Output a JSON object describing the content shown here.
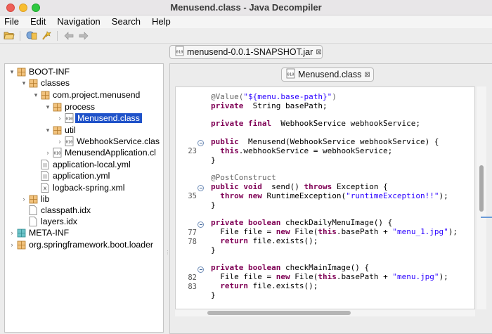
{
  "window": {
    "title": "Menusend.class - Java Decompiler"
  },
  "menubar": [
    "File",
    "Edit",
    "Navigation",
    "Search",
    "Help"
  ],
  "toolbar": [
    "open-folder-icon",
    "open-type-icon",
    "search-icon",
    "back-arrow-icon",
    "forward-arrow-icon"
  ],
  "jar_tab": {
    "label": "menusend-0.0.1-SNAPSHOT.jar"
  },
  "class_tab": {
    "label": "Menusend.class"
  },
  "tree": [
    {
      "label": "BOOT-INF",
      "icon": "package-icon"
    },
    {
      "label": "classes",
      "icon": "package-icon"
    },
    {
      "label": "com.project.menusend",
      "icon": "package-icon"
    },
    {
      "label": "process",
      "icon": "package-icon"
    },
    {
      "label": "Menusend.class",
      "icon": "class-file-icon"
    },
    {
      "label": "util",
      "icon": "package-icon"
    },
    {
      "label": "WebhookService.clas",
      "icon": "class-file-icon"
    },
    {
      "label": "MenusendApplication.cl",
      "icon": "class-file-icon"
    },
    {
      "label": "application-local.yml",
      "icon": "document-icon"
    },
    {
      "label": "application.yml",
      "icon": "document-icon"
    },
    {
      "label": "logback-spring.xml",
      "icon": "xml-file-icon"
    },
    {
      "label": "lib",
      "icon": "package-icon"
    },
    {
      "label": "classpath.idx",
      "icon": "file-icon"
    },
    {
      "label": "layers.idx",
      "icon": "file-icon"
    },
    {
      "label": "META-INF",
      "icon": "package-icon"
    },
    {
      "label": "org.springframework.boot.loader",
      "icon": "package-icon"
    }
  ],
  "code": {
    "line_numbers": [
      "23",
      "35",
      "77",
      "78",
      "82",
      "83"
    ],
    "lines": [
      [
        [
          "ann",
          "@Value("
        ],
        [
          "str",
          "\"${menu.base-path}\""
        ],
        [
          "ann",
          ")"
        ]
      ],
      [
        [
          "kw",
          "private"
        ],
        [
          "",
          "  String basePath;"
        ]
      ],
      [],
      [
        [
          "kw",
          "private final"
        ],
        [
          "",
          "  WebhookService webhookService;"
        ]
      ],
      [],
      [
        [
          "kw",
          "public"
        ],
        [
          "",
          "  Menusend(WebhookService webhookService) {"
        ]
      ],
      [
        [
          "",
          "  "
        ],
        [
          "kw",
          "this"
        ],
        [
          "",
          ".webhookService = webhookService;"
        ]
      ],
      [
        [
          "",
          "}"
        ]
      ],
      [],
      [
        [
          "ann",
          "@PostConstruct"
        ]
      ],
      [
        [
          "kw",
          "public void"
        ],
        [
          "",
          "  send() "
        ],
        [
          "kw",
          "throws"
        ],
        [
          "",
          " Exception {"
        ]
      ],
      [
        [
          "",
          "  "
        ],
        [
          "kw",
          "throw new"
        ],
        [
          "",
          " RuntimeException("
        ],
        [
          "str",
          "\"runtimeException!!\""
        ],
        [
          "",
          ");"
        ]
      ],
      [
        [
          "",
          "}"
        ]
      ],
      [],
      [
        [
          "kw",
          "private boolean"
        ],
        [
          "",
          " checkDailyMenuImage() {"
        ]
      ],
      [
        [
          "",
          "  File file = "
        ],
        [
          "kw",
          "new"
        ],
        [
          "",
          " File("
        ],
        [
          "kw",
          "this"
        ],
        [
          "",
          ".basePath + "
        ],
        [
          "str",
          "\"menu_1.jpg\""
        ],
        [
          "",
          ");"
        ]
      ],
      [
        [
          "",
          "  "
        ],
        [
          "kw",
          "return"
        ],
        [
          "",
          " file.exists();"
        ]
      ],
      [
        [
          "",
          "}"
        ]
      ],
      [],
      [
        [
          "kw",
          "private boolean"
        ],
        [
          "",
          " checkMainImage() {"
        ]
      ],
      [
        [
          "",
          "  File file = "
        ],
        [
          "kw",
          "new"
        ],
        [
          "",
          " File("
        ],
        [
          "kw",
          "this"
        ],
        [
          "",
          ".basePath + "
        ],
        [
          "str",
          "\"menu.jpg\""
        ],
        [
          "",
          ");"
        ]
      ],
      [
        [
          "",
          "  "
        ],
        [
          "kw",
          "return"
        ],
        [
          "",
          " file.exists();"
        ]
      ],
      [
        [
          "",
          "}"
        ]
      ]
    ]
  }
}
